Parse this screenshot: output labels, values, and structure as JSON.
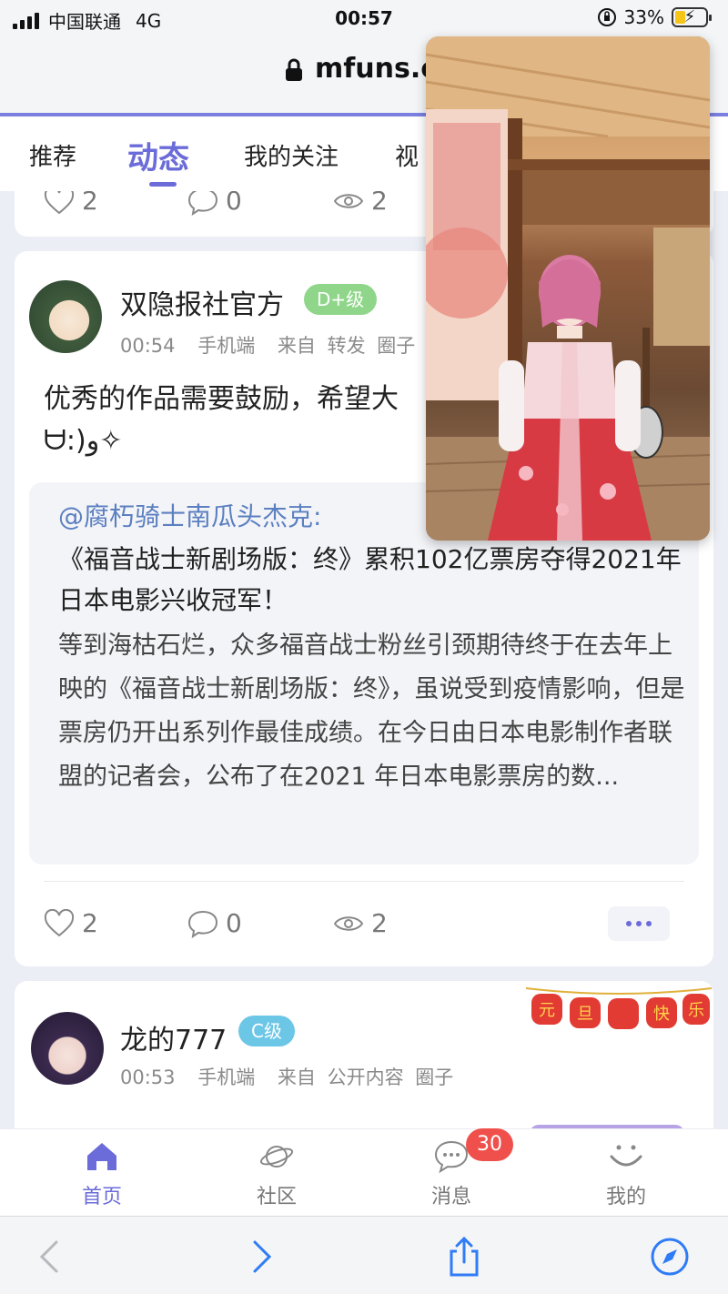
{
  "status_bar": {
    "carrier": "中国联通",
    "network": "4G",
    "time": "00:57",
    "battery": "33%",
    "battery_level": 0.33
  },
  "browser": {
    "url": "mfuns.c"
  },
  "tabs": [
    {
      "label": "推荐"
    },
    {
      "label": "动态",
      "active": true
    },
    {
      "label": "我的关注"
    },
    {
      "label": "视"
    }
  ],
  "top_card": {
    "likes": "2",
    "comments": "0",
    "views": "2"
  },
  "post": {
    "username": "双隐报社官方",
    "level": "D+级",
    "level_color": "#8fd68a",
    "time": "00:54",
    "device": "手机端",
    "source_prefix": "来自",
    "source": "转发",
    "source_suffix": "圈子",
    "text_line1": "优秀的作品需要鼓励，希望大",
    "text_line2": "ᗨ:)و✧",
    "quote": {
      "mention": "@腐朽骑士南瓜头杰克:",
      "headline": "《福音战士新剧场版：终》累积102亿票房夺得2021年日本电影兴收冠军！",
      "excerpt": "等到海枯石烂，众多福音战士粉丝引颈期待终于在去年上映的《福音战士新剧场版：终》，虽说受到疫情影响，但是票房仍开出系列作最佳成绩。在今日由日本电影制作者联盟的记者会，公布了在2021 年日本电影票房的数..."
    },
    "likes": "2",
    "comments": "0",
    "views": "2"
  },
  "next_post": {
    "username": "龙的777",
    "level": "C级",
    "level_color": "#6cc6e6",
    "time": "00:53",
    "device": "手机端",
    "source_prefix": "来自",
    "source": "公开内容",
    "source_suffix": "圈子",
    "banner_chars": [
      "元",
      "旦",
      "快",
      "乐"
    ]
  },
  "bottom_nav": [
    {
      "label": "首页",
      "icon": "home-icon",
      "active": true
    },
    {
      "label": "社区",
      "icon": "planet-icon"
    },
    {
      "label": "消息",
      "icon": "chat-icon",
      "badge": "30"
    },
    {
      "label": "我的",
      "icon": "smile-icon"
    }
  ],
  "colors": {
    "accent": "#6b6bd9",
    "badge_red": "#f0504c",
    "link_blue": "#5b7fc0"
  }
}
